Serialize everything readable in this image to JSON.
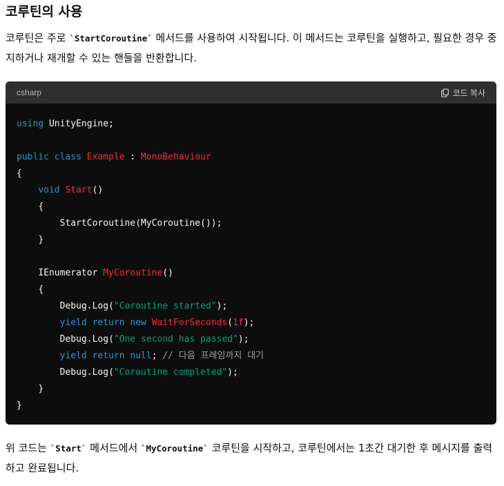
{
  "heading": "코루틴의 사용",
  "intro": {
    "pre": "코루틴은 주로 ",
    "code": "`StartCoroutine`",
    "post": " 메서드를 사용하여 시작됩니다. 이 메서드는 코루틴을 실행하고, 필요한 경우 중지하거나 재개할 수 있는 핸들을 반환합니다."
  },
  "code_block": {
    "language": "csharp",
    "copy_label": "코드 복사",
    "tokens": {
      "using": "using",
      "unity_engine": " UnityEngine;",
      "public": "public",
      "class": "class",
      "example": "Example",
      "colon": " : ",
      "mono": "MonoBehaviour",
      "open_brace": "{",
      "close_brace": "}",
      "void": "void",
      "start": "Start",
      "parens": "()",
      "start_coroutine_call": "StartCoroutine(MyCoroutine());",
      "ienumerator": "IEnumerator ",
      "my_coroutine": "MyCoroutine",
      "debug_log_open": "Debug.Log(",
      "close_paren_semi": ");",
      "str_started": "\"Coroutine started\"",
      "yield": "yield",
      "return": "return",
      "new": "new",
      "wait_for_seconds": "WaitForSeconds",
      "open_paren": "(",
      "num_1f": "1f",
      "str_passed": "\"One second has passed\"",
      "null": "null",
      "semicolon": ";",
      "comment": "// 다음 프레임까지 대기",
      "str_completed": "\"Coroutine completed\""
    }
  },
  "summary": {
    "p1": "위 코드는 ",
    "code1": "`Start`",
    "p2": " 메서드에서 ",
    "code2": "`MyCoroutine`",
    "p3": " 코루틴을 시작하고, 코루틴에서는 1초간 대기한 후 메시지를 출력하고 완료됩니다."
  },
  "colors": {
    "keyword": "#2e95d3",
    "type": "#f22c3d",
    "string": "#00a67d",
    "number": "#df3079",
    "comment": "#a0a0a0",
    "code_bg": "#0d0d0d",
    "code_header_bg": "#2f2f2f"
  },
  "icons": {
    "copy": "copy-icon"
  }
}
